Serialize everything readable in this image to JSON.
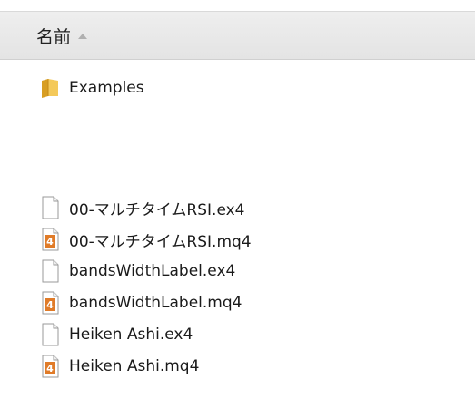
{
  "header": {
    "name_column_label": "名前"
  },
  "items": [
    {
      "label": "Examples",
      "icon": "folder-icon"
    },
    {
      "label": "00-マルチタイムRSI.ex4",
      "icon": "file-icon"
    },
    {
      "label": "00-マルチタイムRSI.mq4",
      "icon": "mq4-file-icon"
    },
    {
      "label": "bandsWidthLabel.ex4",
      "icon": "file-icon"
    },
    {
      "label": "bandsWidthLabel.mq4",
      "icon": "mq4-file-icon"
    },
    {
      "label": "Heiken Ashi.ex4",
      "icon": "file-icon"
    },
    {
      "label": "Heiken Ashi.mq4",
      "icon": "mq4-file-icon"
    }
  ],
  "colors": {
    "folder": "#e8b43a",
    "mq4_accent": "#e07b28"
  }
}
